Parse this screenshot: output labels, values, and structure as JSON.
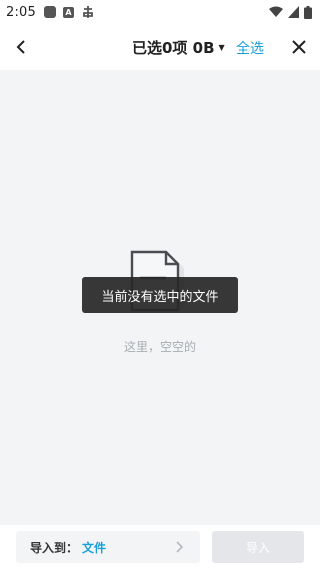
{
  "status_bar": {
    "time": "2:05",
    "a_badge": "A",
    "icons": [
      "app-square-icon",
      "a-badge-icon",
      "notification-glyph-icon",
      "wifi-icon",
      "cell-signal-icon",
      "battery-icon"
    ]
  },
  "header": {
    "title": "已选0项 0B",
    "select_all": "全选",
    "accent_color": "#1aa0d8"
  },
  "main": {
    "empty_text": "这里，空空的",
    "toast": "当前没有选中的文件"
  },
  "bottom_bar": {
    "dest_label": "导入到：",
    "dest_value": "文件",
    "import_label": "导入"
  }
}
